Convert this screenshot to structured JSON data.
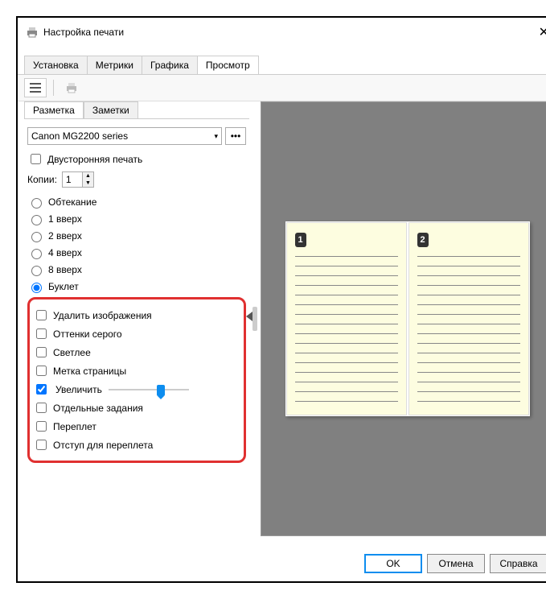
{
  "window": {
    "title": "Настройка печати"
  },
  "tabs": {
    "install": "Установка",
    "metrics": "Метрики",
    "graphics": "Графика",
    "preview": "Просмотр"
  },
  "subtabs": {
    "layout": "Разметка",
    "notes": "Заметки"
  },
  "printer": {
    "selected": "Canon MG2200 series",
    "more": "•••"
  },
  "duplex": {
    "label": "Двусторонняя печать"
  },
  "copies": {
    "label": "Копии:",
    "value": "1"
  },
  "layout_opts": {
    "wrap": "Обтекание",
    "up1": "1 вверх",
    "up2": "2 вверх",
    "up4": "4 вверх",
    "up8": "8 вверх",
    "booklet": "Буклет"
  },
  "extra": {
    "remove_images": "Удалить изображения",
    "grayscale": "Оттенки серого",
    "lighter": "Светлее",
    "page_mark": "Метка страницы",
    "enlarge": "Увеличить",
    "separate_jobs": "Отдельные задания",
    "binding": "Переплет",
    "binding_indent": "Отступ для переплета"
  },
  "preview_pages": {
    "p1": "1",
    "p2": "2"
  },
  "buttons": {
    "ok": "OK",
    "cancel": "Отмена",
    "help": "Справка"
  }
}
